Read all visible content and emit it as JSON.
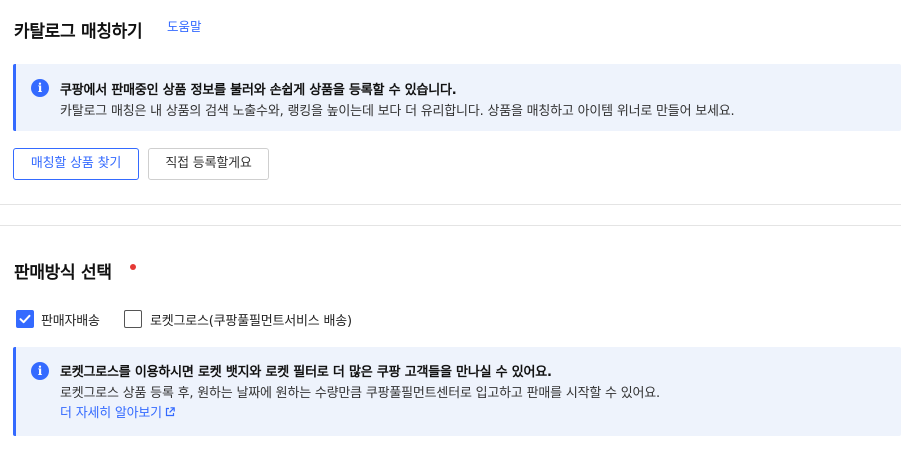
{
  "catalog": {
    "title": "카탈로그 매칭하기",
    "help_label": "도움말",
    "info": {
      "icon": "info-icon",
      "line1": "쿠팡에서 판매중인 상품 정보를 불러와 손쉽게 상품을 등록할 수 있습니다.",
      "line2": "카탈로그 매칭은 내 상품의 검색 노출수와, 랭킹을 높이는데 보다 더 유리합니다. 상품을 매칭하고 아이템 위너로 만들어 보세요."
    },
    "find_button": "매칭할 상품 찾기",
    "direct_button": "직접 등록할게요"
  },
  "sales_method": {
    "title": "판매방식 선택",
    "required": true,
    "options": [
      {
        "label": "판매자배송",
        "checked": true
      },
      {
        "label": "로켓그로스(쿠팡풀필먼트서비스 배송)",
        "checked": false
      }
    ],
    "info": {
      "icon": "info-icon",
      "line1": "로켓그로스를 이용하시면 로켓 뱃지와 로켓 필터로 더 많은 쿠팡 고객들을 만나실 수 있어요.",
      "line2": "로켓그로스 상품 등록 후, 원하는 날짜에 원하는 수량만큼 쿠팡풀필먼트센터로 입고하고 판매를 시작할 수 있어요.",
      "link": "더 자세히 알아보기",
      "link_icon": "external-link-icon"
    }
  },
  "colors": {
    "accent": "#346aff",
    "info_bg": "#eef3fc",
    "required": "#e53935"
  }
}
